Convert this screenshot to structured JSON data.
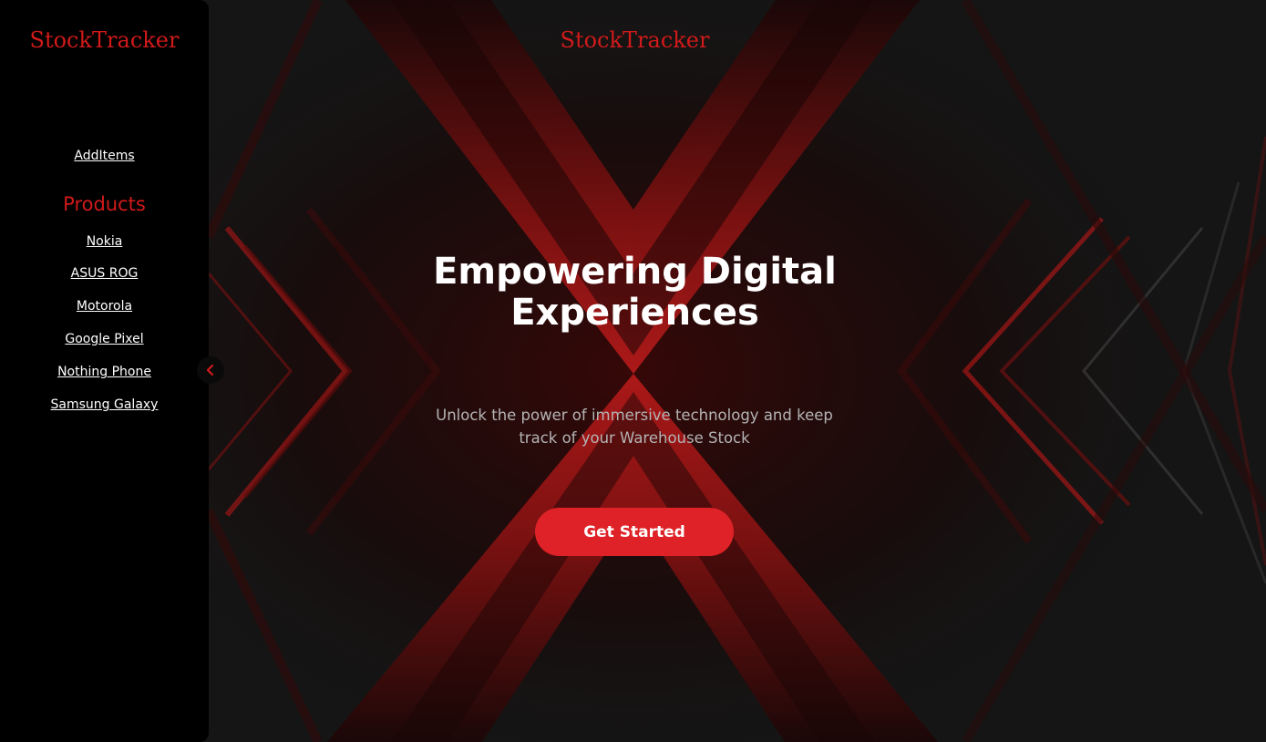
{
  "brand": {
    "name": "StockTracker"
  },
  "sidebar": {
    "logo": "StockTracker",
    "add_items": "AddItems",
    "products_heading": "Products",
    "products": [
      {
        "label": "Nokia"
      },
      {
        "label": "ASUS ROG"
      },
      {
        "label": "Motorola"
      },
      {
        "label": "Google Pixel"
      },
      {
        "label": "Nothing Phone"
      },
      {
        "label": "Samsung Galaxy"
      }
    ]
  },
  "hero": {
    "title_line1": "Empowering Digital",
    "title_line2": "Experiences",
    "subtitle_line1": "Unlock the power of immersive technology and keep",
    "subtitle_line2": "track of your Warehouse Stock",
    "cta_label": "Get Started"
  },
  "colors": {
    "accent": "#d11a1a",
    "button": "#de2227",
    "background": "#151515",
    "sidebar": "#000000"
  },
  "icons": {
    "collapse": "chevron-left-icon"
  }
}
